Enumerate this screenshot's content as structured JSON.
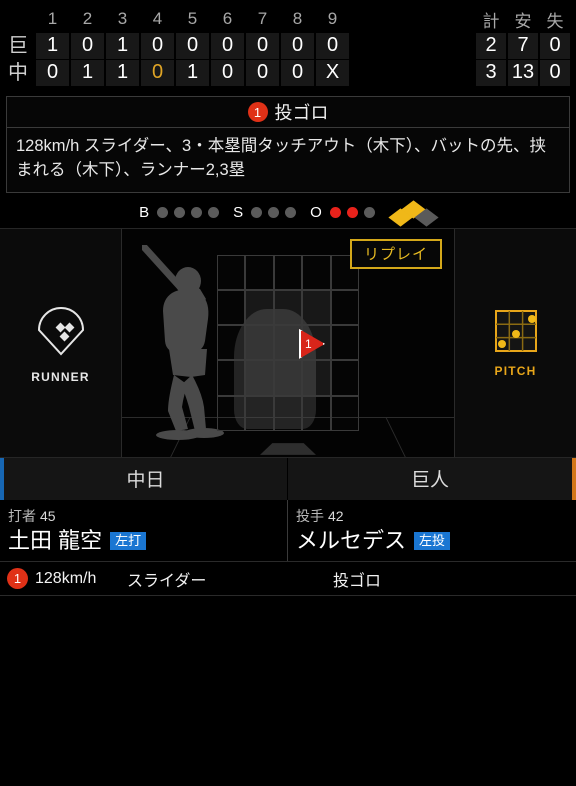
{
  "scoreboard": {
    "innings": [
      "1",
      "2",
      "3",
      "4",
      "5",
      "6",
      "7",
      "8",
      "9"
    ],
    "total_headers": [
      "計",
      "安",
      "失"
    ],
    "rows": [
      {
        "team": "巨",
        "scores": [
          "1",
          "0",
          "1",
          "0",
          "0",
          "0",
          "0",
          "0",
          "0"
        ],
        "highlight_index": -1,
        "totals": [
          "2",
          "7",
          "0"
        ]
      },
      {
        "team": "中",
        "scores": [
          "0",
          "1",
          "1",
          "0",
          "1",
          "0",
          "0",
          "0",
          "X"
        ],
        "highlight_index": 3,
        "totals": [
          "3",
          "13",
          "0"
        ]
      }
    ]
  },
  "result": {
    "pitch_number": "1",
    "title": "投ゴロ",
    "detail": "128km/h スライダー、3・本塁間タッチアウト（木下）、バットの先、挟まれる（木下）、ランナー2,3塁"
  },
  "count": {
    "ball_label": "B",
    "ball_dots": [
      false,
      false,
      false,
      false
    ],
    "strike_label": "S",
    "strike_dots": [
      false,
      false,
      false
    ],
    "out_label": "O",
    "out_dots": [
      true,
      true,
      false
    ],
    "bases": {
      "first": false,
      "second": true,
      "third": true
    }
  },
  "stage": {
    "runner_label": "RUNNER",
    "pitch_label": "PITCH",
    "replay_label": "リプレイ",
    "marker_number": "1"
  },
  "team_tabs": {
    "home": "中日",
    "away": "巨人",
    "home_accent": "#1767b4",
    "away_accent": "#d2761a"
  },
  "players": {
    "batter": {
      "role": "打者",
      "number": "45",
      "name": "土田 龍空",
      "hand": "左打"
    },
    "pitcher": {
      "role": "投手",
      "number": "42",
      "name": "メルセデス",
      "hand": "左投"
    }
  },
  "pitch_log": [
    {
      "number": "1",
      "speed": "128km/h",
      "type": "スライダー",
      "result": "投ゴロ"
    }
  ]
}
